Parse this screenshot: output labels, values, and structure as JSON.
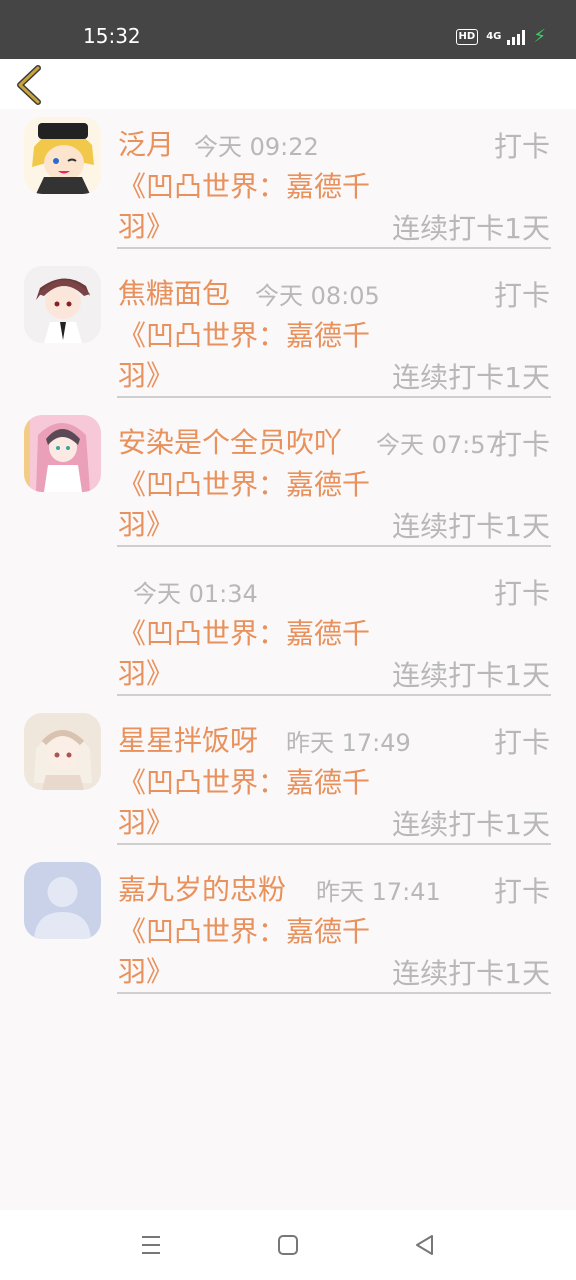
{
  "status_bar": {
    "time": "15:32",
    "hd": "HD",
    "network": "4G",
    "icons": [
      "hd-icon",
      "signal-icon",
      "charging-icon"
    ]
  },
  "header": {
    "back_icon": "chevron-left-icon"
  },
  "feed": [
    {
      "name": "泛月",
      "time": "今天 09:22",
      "tag": "打卡",
      "book": "《凹凸世界：嘉德千羽》",
      "streak": "连续打卡1天",
      "avatar": "avatar-anime-blonde"
    },
    {
      "name": "焦糖面包",
      "time": "今天 08:05",
      "tag": "打卡",
      "book": "《凹凸世界：嘉德千羽》",
      "streak": "连续打卡1天",
      "avatar": "avatar-anime-brown"
    },
    {
      "name": "安染是个全员吹吖",
      "time": "今天 07:57",
      "tag": "打卡",
      "book": "《凹凸世界：嘉德千羽》",
      "streak": "连续打卡1天",
      "avatar": "avatar-anime-pink"
    },
    {
      "name": "",
      "time": "今天 01:34",
      "tag": "打卡",
      "book": "《凹凸世界：嘉德千羽》",
      "streak": "连续打卡1天",
      "avatar": "none"
    },
    {
      "name": "星星拌饭呀",
      "time": "昨天 17:49",
      "tag": "打卡",
      "book": "《凹凸世界：嘉德千羽》",
      "streak": "连续打卡1天",
      "avatar": "avatar-anime-cream"
    },
    {
      "name": "嘉九岁的忠粉",
      "time": "昨天 17:41",
      "tag": "打卡",
      "book": "《凹凸世界：嘉德千羽》",
      "streak": "连续打卡1天",
      "avatar": "default-avatar-icon"
    }
  ],
  "nav_bar": {
    "icons": [
      "menu-icon",
      "home-square-icon",
      "back-triangle-icon"
    ]
  },
  "colors": {
    "accent": "#e8915c",
    "muted": "#b8b8b8",
    "back_icon": "#c9a43a",
    "status_bar": "#454545"
  }
}
